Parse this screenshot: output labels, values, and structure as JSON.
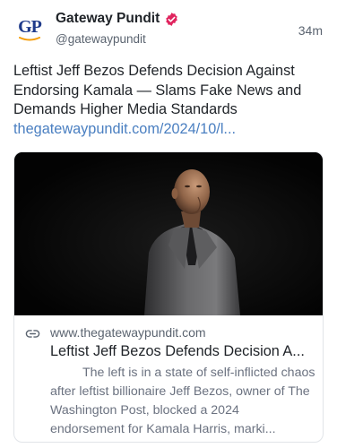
{
  "post": {
    "author": {
      "display_name": "Gateway Pundit",
      "handle": "@gatewaypundit",
      "avatar_text": "GP",
      "verified": true
    },
    "timestamp": "34m",
    "text": "Leftist Jeff Bezos Defends Decision Against Endorsing Kamala — Slams Fake News and Demands Higher Media Standards",
    "link_text": "thegatewaypundit.com/2024/10/l..."
  },
  "link_card": {
    "domain": "www.thegatewaypundit.com",
    "title": "Leftist Jeff Bezos Defends Decision A...",
    "description": "The left is in a state of self-inflicted chaos after leftist billionaire Jeff Bezos, owner of The Washington Post, blocked a 2024 endorsement for Kamala Harris, marki...",
    "image_subject": "man-in-grey-blazer-on-dark-background"
  },
  "icons": {
    "verified": "verified-badge-icon",
    "link": "link-icon"
  },
  "colors": {
    "link": "#4a7fc1",
    "verified_badge": "#e0245e",
    "avatar_text": "#1e3a8a",
    "avatar_swoosh": "#f59e0b",
    "muted_text": "#5b6470"
  }
}
